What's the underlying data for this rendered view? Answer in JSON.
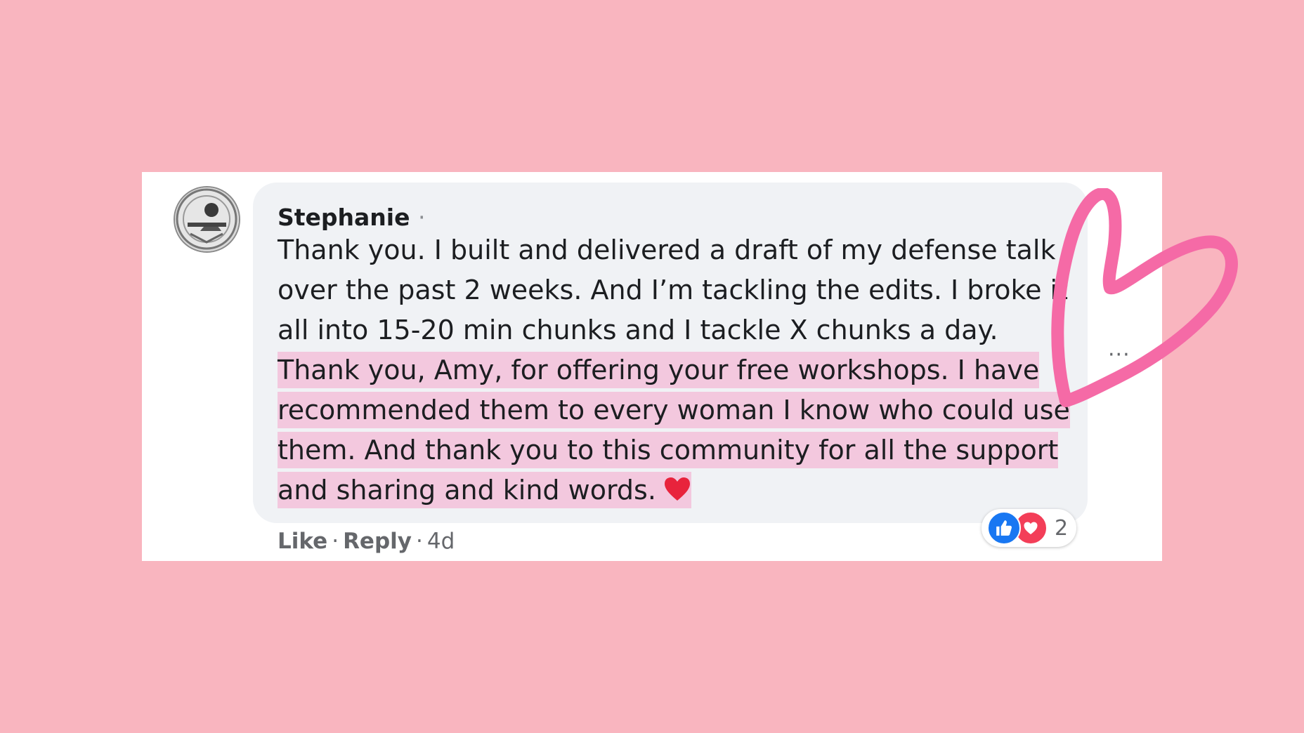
{
  "comment": {
    "author": "Stephanie",
    "author_separator": "·",
    "text_plain": "Thank you. I built and delivered a draft of my defense talk over the past 2 weeks. And I’m tackling the edits. I broke it all into 15-20 min chunks and I tackle X chunks a day.",
    "text_highlighted": "Thank you, Amy, for offering your free workshops. I have recommended them to every woman I know who could use them. And thank you to this community for all the support and sharing and kind words.",
    "emoji": "red-heart-emoji"
  },
  "reactions": {
    "icons": [
      "like-icon",
      "love-icon"
    ],
    "count": "2"
  },
  "actions": {
    "like_label": "Like",
    "reply_label": "Reply",
    "separator": "·",
    "timestamp": "4d"
  },
  "more_options_label": "···",
  "colors": {
    "background": "#f9b5bf",
    "bubble": "#f0f2f5",
    "highlight": "#f3c8de",
    "drawn_heart": "#f56aa6",
    "like_blue": "#1877f2",
    "love_red": "#f33e58"
  }
}
